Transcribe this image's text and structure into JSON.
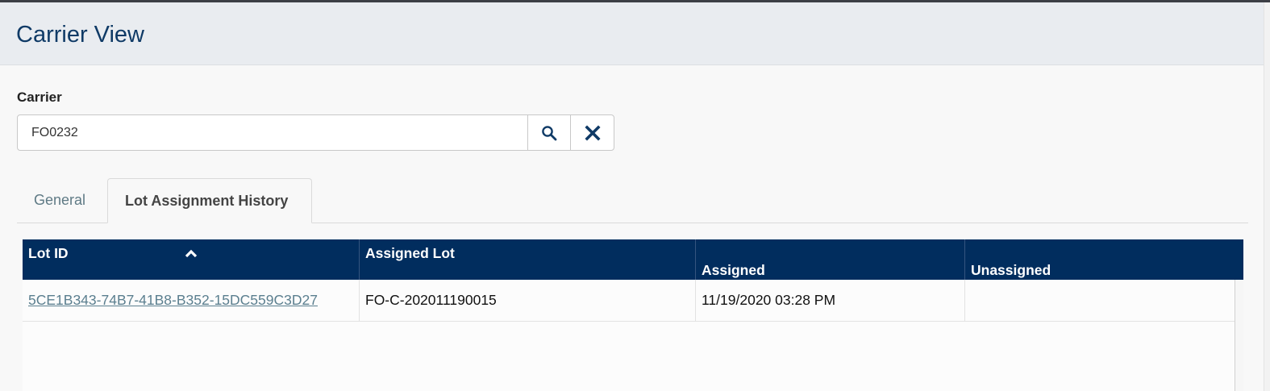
{
  "page": {
    "title": "Carrier View"
  },
  "carrier": {
    "label": "Carrier",
    "value": "FO0232",
    "search_icon": "search-icon",
    "clear_icon": "close-icon"
  },
  "tabs": [
    {
      "label": "General",
      "active": false
    },
    {
      "label": "Lot Assignment History",
      "active": true
    }
  ],
  "grid": {
    "columns": [
      {
        "label": "Lot ID",
        "sort": "ascending"
      },
      {
        "label": "Assigned Lot"
      },
      {
        "label": "Assigned\nDate/Time"
      },
      {
        "label": "Unassigned\nDate/Time"
      }
    ],
    "rows": [
      {
        "lot_id": "5CE1B343-74B7-41B8-B352-15DC559C3D27",
        "assigned_lot": "FO-C-202011190015",
        "assigned_datetime": "11/19/2020 03:28 PM",
        "unassigned_datetime": ""
      }
    ]
  },
  "colors": {
    "header_bg": "#012d5e",
    "title": "#0f3a66",
    "link": "#5b7f8f"
  }
}
